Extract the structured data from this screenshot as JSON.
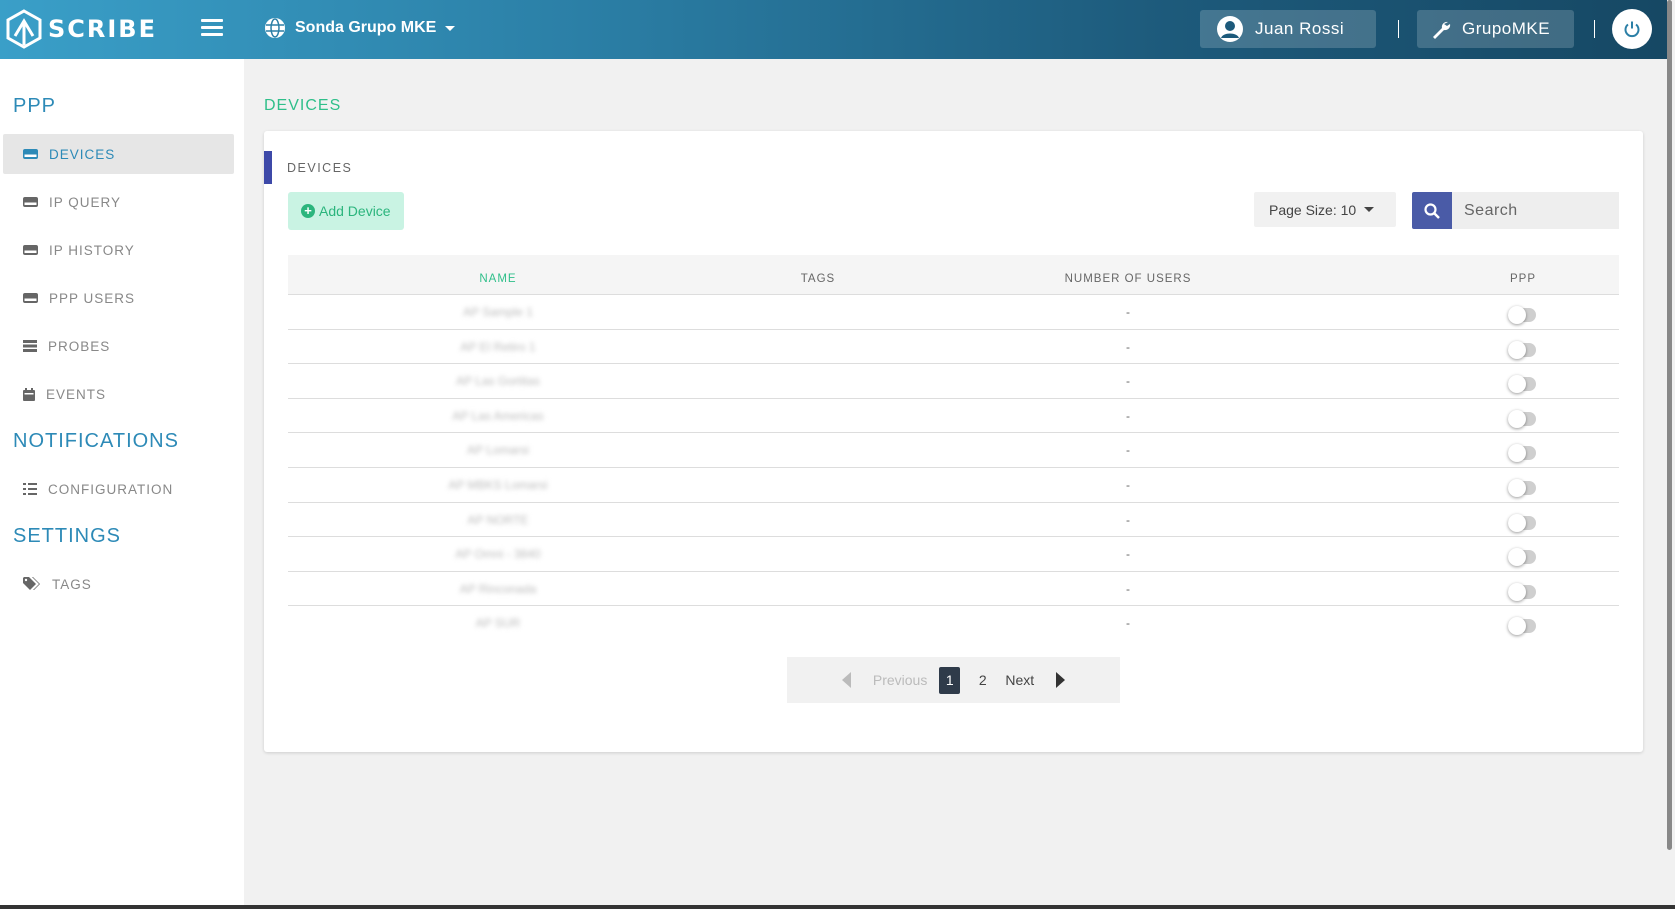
{
  "brand": {
    "name": "SCRIBE"
  },
  "topbar": {
    "org_selector": "Sonda Grupo MKE",
    "user_name": "Juan Rossi",
    "org_name": "GrupoMKE"
  },
  "sidebar": {
    "sections": [
      {
        "title": "PPP"
      },
      {
        "title": "NOTIFICATIONS"
      },
      {
        "title": "SETTINGS"
      }
    ],
    "items": [
      {
        "label": "DEVICES",
        "icon": "hdd-icon",
        "active": true
      },
      {
        "label": "IP QUERY",
        "icon": "hdd-icon"
      },
      {
        "label": "IP HISTORY",
        "icon": "hdd-icon"
      },
      {
        "label": "PPP USERS",
        "icon": "hdd-icon"
      },
      {
        "label": "PROBES",
        "icon": "server-icon"
      },
      {
        "label": "EVENTS",
        "icon": "calendar-icon"
      },
      {
        "label": "CONFIGURATION",
        "icon": "list-check-icon"
      },
      {
        "label": "TAGS",
        "icon": "tags-icon"
      }
    ]
  },
  "main": {
    "page_title": "DEVICES",
    "card_title": "DEVICES",
    "add_button": "Add Device",
    "page_size_label": "Page Size: 10",
    "search_placeholder": "Search",
    "columns": [
      "NAME",
      "TAGS",
      "NUMBER OF USERS",
      "PPP"
    ],
    "rows": [
      {
        "name": "AP Sample 1",
        "tags": "",
        "users": "-",
        "ppp": false
      },
      {
        "name": "AP El Retiro 1",
        "tags": "",
        "users": "-",
        "ppp": false
      },
      {
        "name": "AP Las Gortitas",
        "tags": "",
        "users": "-",
        "ppp": false
      },
      {
        "name": "AP Las Americas",
        "tags": "",
        "users": "-",
        "ppp": false
      },
      {
        "name": "AP Lomarsi",
        "tags": "",
        "users": "-",
        "ppp": false
      },
      {
        "name": "AP MBKS Lomarsi",
        "tags": "",
        "users": "-",
        "ppp": false
      },
      {
        "name": "AP NORTE",
        "tags": "",
        "users": "-",
        "ppp": false
      },
      {
        "name": "AP Omni - 3840",
        "tags": "",
        "users": "-",
        "ppp": false
      },
      {
        "name": "AP Rinconada",
        "tags": "",
        "users": "-",
        "ppp": false
      },
      {
        "name": "AP SUR",
        "tags": "",
        "users": "-",
        "ppp": false
      }
    ],
    "pagination": {
      "previous": "Previous",
      "pages": [
        "1",
        "2"
      ],
      "current": "1",
      "next": "Next"
    }
  },
  "colors": {
    "accent_blue": "#2d8ab7",
    "accent_green": "#2fbf8a",
    "search_button": "#4a5ba7",
    "card_accent": "#3d49a8"
  }
}
